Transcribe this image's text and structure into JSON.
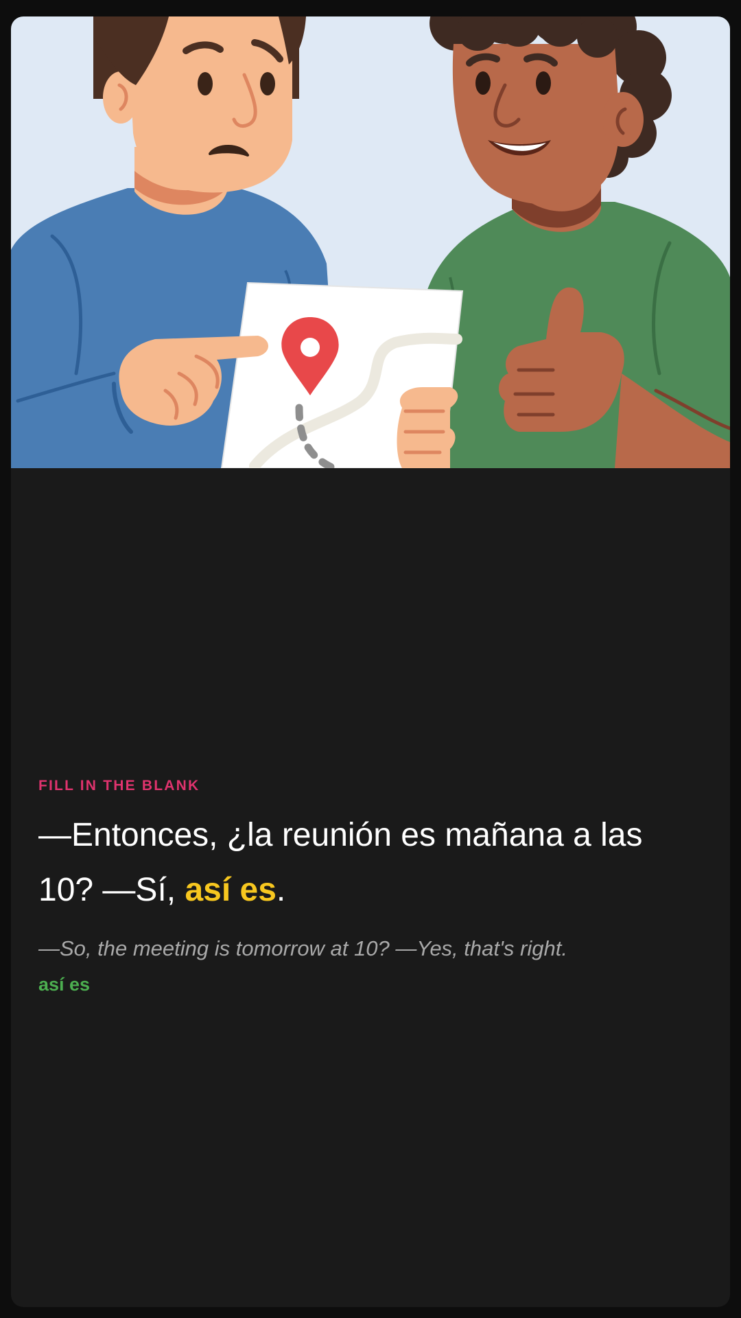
{
  "card": {
    "illustration": {
      "name": "two-people-reading-map-illustration",
      "colors": {
        "background": "#dfe9f5",
        "left_shirt": "#4a7db4",
        "right_shirt": "#4f8a58",
        "map_pin": "#e8484a"
      }
    },
    "exercise": {
      "label": "FILL IN THE BLANK",
      "sentence_before": "—Entonces, ¿la reunión es mañana a las 10? —Sí, ",
      "answer": "así es",
      "sentence_after": ".",
      "translation": "—So, the meeting is tomorrow at 10? —Yes, that's right.",
      "answer_tag": "así es"
    }
  },
  "colors": {
    "page_bg": "#0d0d0d",
    "card_bg": "#1a1a1a",
    "label": "#e0336e",
    "answer_highlight": "#f7c71f",
    "answer_tag": "#4caf50",
    "translation": "#a9a9a9"
  }
}
